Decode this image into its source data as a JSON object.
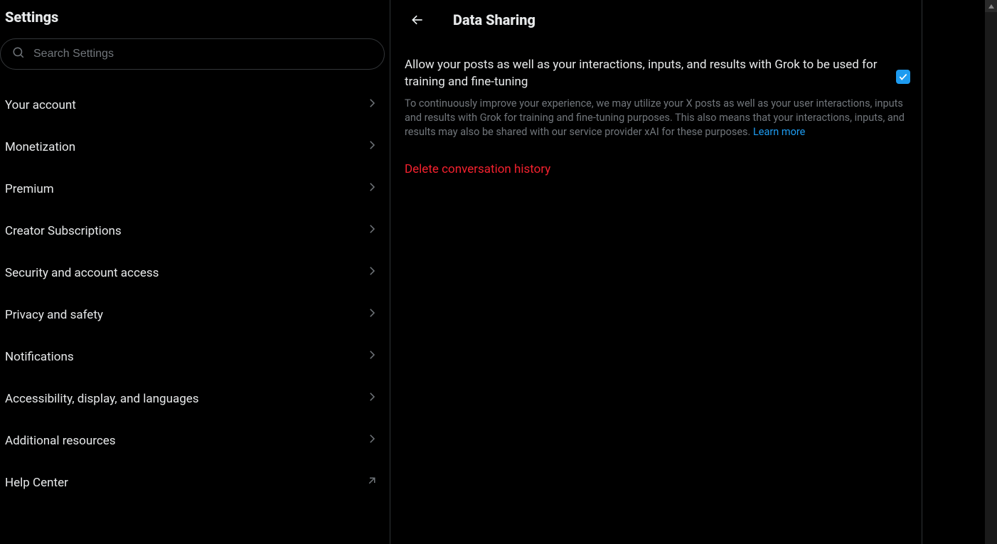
{
  "sidebar": {
    "title": "Settings",
    "search_placeholder": "Search Settings",
    "items": [
      {
        "label": "Your account",
        "external": false
      },
      {
        "label": "Monetization",
        "external": false
      },
      {
        "label": "Premium",
        "external": false
      },
      {
        "label": "Creator Subscriptions",
        "external": false
      },
      {
        "label": "Security and account access",
        "external": false
      },
      {
        "label": "Privacy and safety",
        "external": false
      },
      {
        "label": "Notifications",
        "external": false
      },
      {
        "label": "Accessibility, display, and languages",
        "external": false
      },
      {
        "label": "Additional resources",
        "external": false
      },
      {
        "label": "Help Center",
        "external": true
      }
    ]
  },
  "main": {
    "title": "Data Sharing",
    "setting_label": "Allow your posts as well as your interactions, inputs, and results with Grok to be used for training and fine-tuning",
    "setting_desc": "To continuously improve your experience, we may utilize your X posts as well as your user interactions, inputs and results with Grok for training and fine-tuning purposes. This also means that your interactions, inputs, and results may also be shared with our service provider xAI for these purposes. ",
    "learn_more": "Learn more",
    "checkbox_checked": true,
    "delete_label": "Delete conversation history"
  }
}
